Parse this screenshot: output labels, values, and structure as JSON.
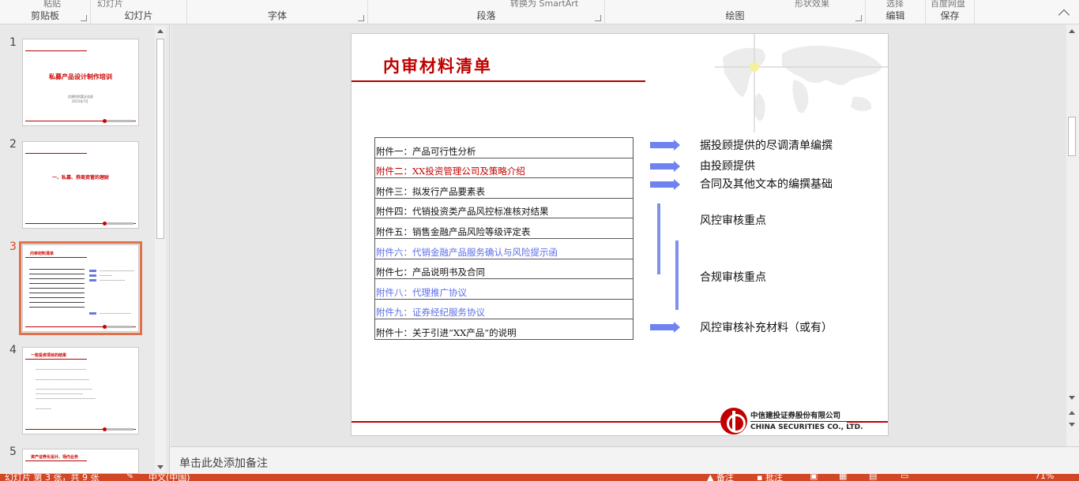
{
  "ribbon": {
    "groups": [
      {
        "name": "剪贴板",
        "top_label": "粘贴"
      },
      {
        "name": "幻灯片",
        "top_label": "幻灯片"
      },
      {
        "name": "字体"
      },
      {
        "name": "段落",
        "top_label": "转换为 SmartArt"
      },
      {
        "name": "绘图",
        "top_label": "形状效果"
      },
      {
        "name": "编辑",
        "top_label": "选择"
      },
      {
        "name": "保存",
        "top_label": "百度网盘"
      }
    ]
  },
  "thumbnails": [
    {
      "num": "1",
      "title": "私募产品设计制作培训",
      "sub1": "信建投财富业务部",
      "sub2": "2015年7月"
    },
    {
      "num": "2",
      "title": "一、私募、券商资管的理财"
    },
    {
      "num": "3",
      "title": "内审材料清单"
    },
    {
      "num": "4",
      "title": "一些投资项目的结果"
    },
    {
      "num": "5",
      "title": "资产证券化设计、场内业务"
    }
  ],
  "slide": {
    "title": "内审材料清单",
    "attachments": [
      {
        "text": "附件一：产品可行性分析",
        "color": "black"
      },
      {
        "text": "附件二：XX投资管理公司及策略介绍",
        "color": "red"
      },
      {
        "text": "附件三：拟发行产品要素表",
        "color": "black"
      },
      {
        "text": "附件四：代销投资类产品风控标准核对结果",
        "color": "black"
      },
      {
        "text": "附件五：销售金融产品风险等级评定表",
        "color": "black"
      },
      {
        "text": "附件六：代销金融产品服务确认与风险提示函",
        "color": "blue"
      },
      {
        "text": "附件七：产品说明书及合同",
        "color": "black"
      },
      {
        "text": "附件八：代理推广协议",
        "color": "blue"
      },
      {
        "text": "附件九：证券经纪服务协议",
        "color": "blue"
      },
      {
        "text": "附件十：关于引进“XX产品”的说明",
        "color": "black"
      }
    ],
    "notes": [
      "据投顾提供的尽调清单编撰",
      "由投顾提供",
      "合同及其他文本的编撰基础",
      "风控审核重点",
      "合规审核重点",
      "风控审核补充材料（或有）"
    ],
    "logo_cn": "中信建投证券股份有限公司",
    "logo_en": "CHINA SECURITIES CO., LTD."
  },
  "notes_pane": {
    "placeholder": "单击此处添加备注"
  },
  "statusbar": {
    "slide_info": "幻灯片 第 3 张，共 9 张",
    "language": "中文(中国)",
    "notes_btn": "备注",
    "comments_btn": "批注",
    "zoom": "71%"
  },
  "colors": {
    "accent": "#d24726",
    "brand_red": "#c00000",
    "arrow_blue": "#6f82f0"
  }
}
